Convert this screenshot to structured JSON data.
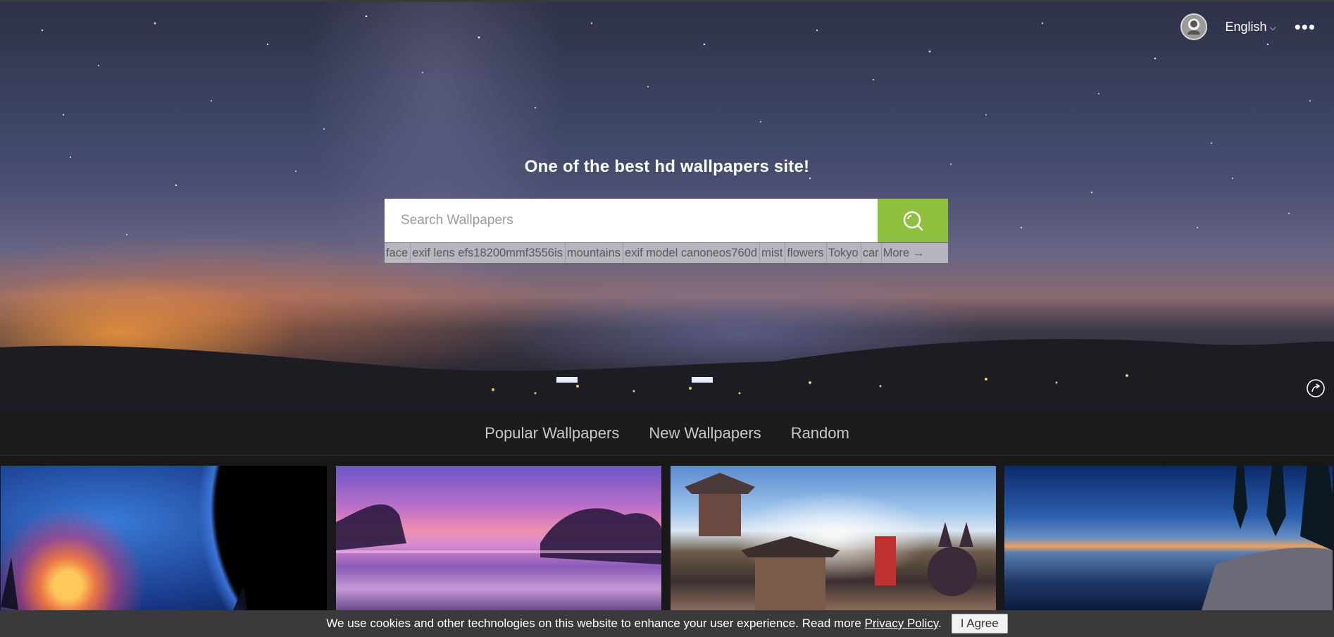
{
  "header": {
    "language": "English",
    "avatar_icon": "user-avatar-icon",
    "more_icon": "more-dots-icon"
  },
  "hero": {
    "tagline": "One of the best hd wallpapers site!",
    "search": {
      "placeholder": "Search Wallpapers",
      "value": "",
      "button_icon": "search-icon"
    },
    "tags": [
      "face",
      "exif lens efs18200mmf3556is",
      "mountains",
      "exif model canoneos760d",
      "mist",
      "flowers",
      "Tokyo",
      "car",
      "More →"
    ],
    "share_icon": "share-icon"
  },
  "nav": {
    "items": [
      "Popular Wallpapers",
      "New Wallpapers",
      "Random"
    ]
  },
  "gallery": {
    "thumbs": [
      "space-nebula-wallpaper",
      "purple-lake-sunset-wallpaper",
      "anime-japanese-town-wallpaper",
      "coastal-sunset-wallpaper"
    ]
  },
  "cookie": {
    "text": "We use cookies and other technologies on this website to enhance your user experience. Read more ",
    "link": "Privacy Policy",
    "suffix": ".",
    "button": "I Agree"
  },
  "colors": {
    "search_button": "#8fbf3f",
    "nav_bg": "#1c1c1c",
    "cookie_bg": "#3a3a3a"
  }
}
